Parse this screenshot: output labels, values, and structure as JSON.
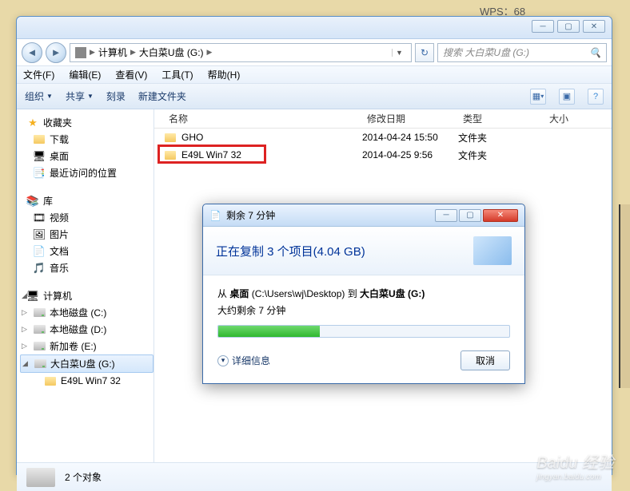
{
  "bg_app": "WPS：68",
  "breadcrumb": {
    "root": "计算机",
    "drive": "大白菜U盘 (G:)"
  },
  "search_placeholder": "搜索 大白菜U盘 (G:)",
  "menus": {
    "file": "文件(F)",
    "edit": "编辑(E)",
    "view": "查看(V)",
    "tools": "工具(T)",
    "help": "帮助(H)"
  },
  "toolbar": {
    "organize": "组织",
    "share": "共享",
    "burn": "刻录",
    "newfolder": "新建文件夹"
  },
  "columns": {
    "name": "名称",
    "date": "修改日期",
    "type": "类型",
    "size": "大小"
  },
  "files": [
    {
      "name": "GHO",
      "date": "2014-04-24 15:50",
      "type": "文件夹"
    },
    {
      "name": "E49L Win7 32",
      "date": "2014-04-25 9:56",
      "type": "文件夹"
    }
  ],
  "sidebar": {
    "fav": {
      "label": "收藏夹",
      "items": [
        "下载",
        "桌面",
        "最近访问的位置"
      ]
    },
    "lib": {
      "label": "库",
      "items": [
        "视频",
        "图片",
        "文档",
        "音乐"
      ]
    },
    "comp": {
      "label": "计算机",
      "items": [
        "本地磁盘 (C:)",
        "本地磁盘 (D:)",
        "新加卷 (E:)",
        "大白菜U盘 (G:)",
        "E49L Win7 32"
      ]
    }
  },
  "status": "2 个对象",
  "dialog": {
    "title": "剩余 7 分钟",
    "header": "正在复制 3 个项目(4.04 GB)",
    "line1_pre": "从 ",
    "line1_b1": "桌面",
    "line1_mid": " (C:\\Users\\wj\\Desktop) 到 ",
    "line1_b2": "大白菜U盘 (G:)",
    "line2": "大约剩余 7 分钟",
    "details": "详细信息",
    "cancel": "取消"
  },
  "watermark": {
    "main": "Baidu 经验",
    "sub": "jingyan.baidu.com"
  }
}
